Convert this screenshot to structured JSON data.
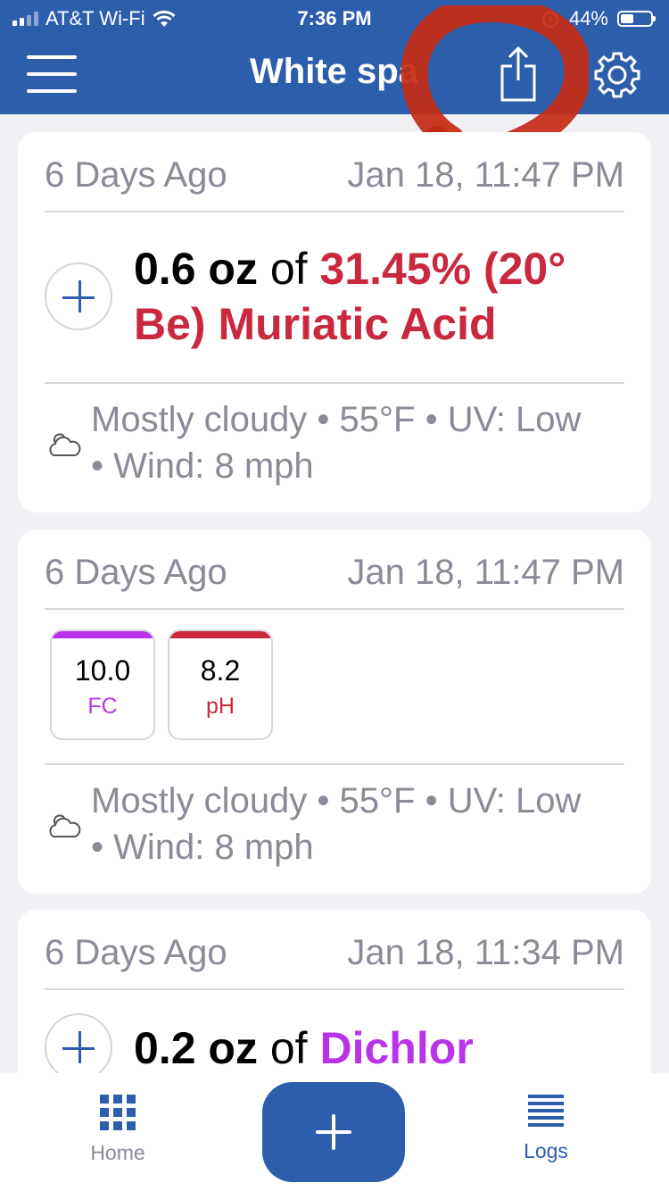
{
  "status_bar": {
    "carrier": "AT&T Wi-Fi",
    "time": "7:36 PM",
    "battery": "44%"
  },
  "nav": {
    "title": "White spa"
  },
  "logs": [
    {
      "ago": "6 Days Ago",
      "date": "Jan 18, 11:47 PM",
      "amount": "0.6 oz",
      "of": "of",
      "chemical": "31.45% (20° Be) Muriatic Acid",
      "weather_line1": "Mostly cloudy • 55°F • UV: Low",
      "weather_line2": "• Wind: 8 mph"
    },
    {
      "ago": "6 Days Ago",
      "date": "Jan 18, 11:47 PM",
      "readings": [
        {
          "value": "10.0",
          "label": "FC",
          "color": "#b934e8"
        },
        {
          "value": "8.2",
          "label": "pH",
          "color": "#c9283e"
        }
      ],
      "weather_line1": "Mostly cloudy • 55°F • UV: Low",
      "weather_line2": "• Wind: 8 mph"
    },
    {
      "ago": "6 Days Ago",
      "date": "Jan 18, 11:34 PM",
      "amount": "0.2 oz",
      "of": "of",
      "chemical": "Dichlor"
    }
  ],
  "tabs": {
    "home": "Home",
    "logs": "Logs"
  },
  "colors": {
    "brand_blue": "#2d5eab",
    "acid_red": "#c9283e",
    "chlorine_purple": "#b934e8",
    "annotation_red": "#c42a12"
  }
}
